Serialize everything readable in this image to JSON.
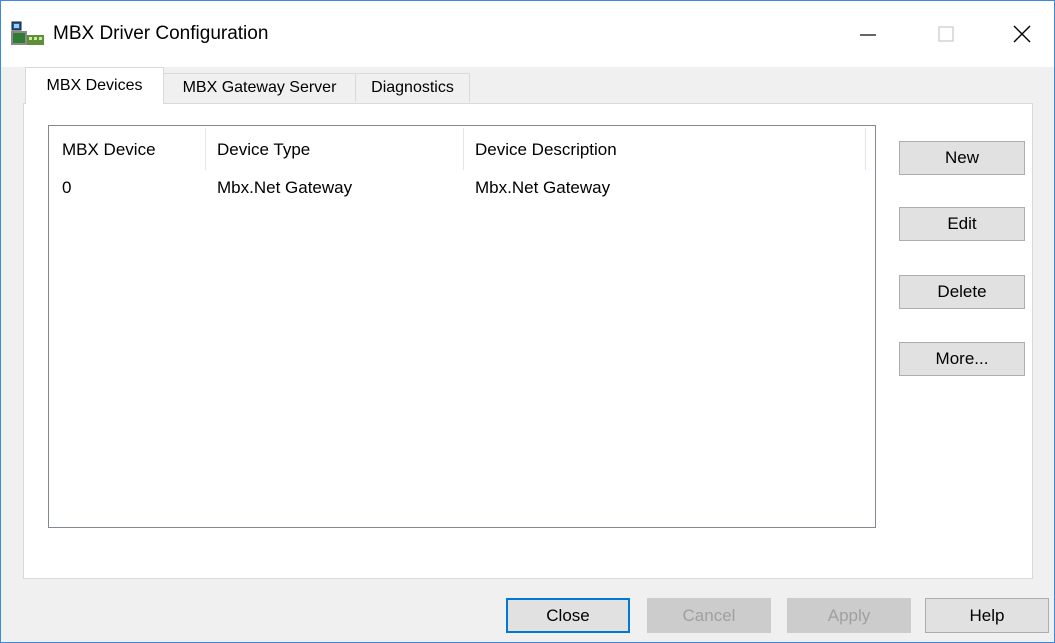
{
  "window": {
    "title": "MBX Driver Configuration",
    "icon": "network-driver-icon"
  },
  "tabs": [
    {
      "label": "MBX Devices",
      "active": true
    },
    {
      "label": "MBX Gateway Server",
      "active": false
    },
    {
      "label": "Diagnostics",
      "active": false
    }
  ],
  "device_list": {
    "columns": [
      "MBX Device",
      "Device Type",
      "Device Description"
    ],
    "rows": [
      {
        "device": "0",
        "type": "Mbx.Net Gateway",
        "description": "Mbx.Net Gateway"
      }
    ]
  },
  "side_buttons": {
    "new": "New",
    "edit": "Edit",
    "delete": "Delete",
    "more": "More..."
  },
  "bottom_buttons": {
    "close": "Close",
    "cancel": "Cancel",
    "apply": "Apply",
    "help": "Help"
  },
  "colors": {
    "accent": "#0078d7",
    "window_border": "#3c8ad8"
  }
}
